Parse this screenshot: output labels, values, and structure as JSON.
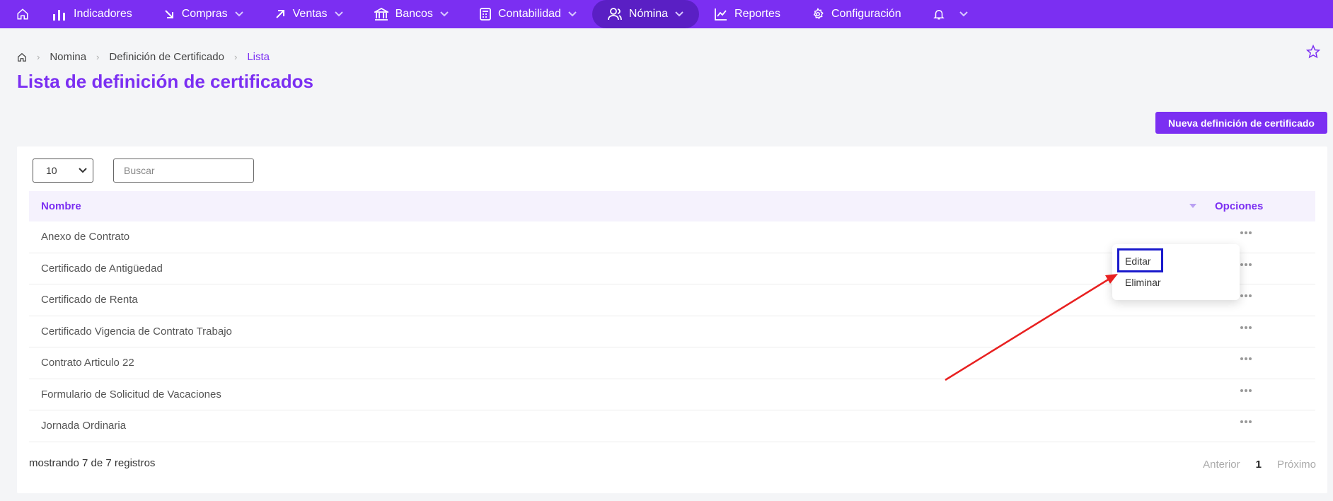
{
  "nav": {
    "items": [
      {
        "label": "Indicadores",
        "dropdown": false
      },
      {
        "label": "Compras",
        "dropdown": true
      },
      {
        "label": "Ventas",
        "dropdown": true
      },
      {
        "label": "Bancos",
        "dropdown": true
      },
      {
        "label": "Contabilidad",
        "dropdown": true
      },
      {
        "label": "Nómina",
        "dropdown": true,
        "active": true
      },
      {
        "label": "Reportes",
        "dropdown": false
      },
      {
        "label": "Configuración",
        "dropdown": false
      }
    ]
  },
  "breadcrumb": {
    "items": [
      "Nomina",
      "Definición de Certificado"
    ],
    "current": "Lista"
  },
  "page": {
    "title": "Lista de definición de certificados",
    "new_button": "Nueva definición de certificado"
  },
  "table": {
    "page_size": "10",
    "search_placeholder": "Buscar",
    "columns": {
      "name": "Nombre",
      "options": "Opciones"
    },
    "rows": [
      "Anexo de Contrato",
      "Certificado de Antigüedad",
      "Certificado de Renta",
      "Certificado Vigencia de Contrato Trabajo",
      "Contrato Articulo 22",
      "Formulario de Solicitud de Vacaciones",
      "Jornada Ordinaria"
    ],
    "footer": "mostrando 7 de 7 registros",
    "pager": {
      "prev": "Anterior",
      "page": "1",
      "next": "Próximo"
    }
  },
  "menu": {
    "edit": "Editar",
    "delete": "Eliminar"
  },
  "colors": {
    "brand": "#7b2ff2",
    "nav_active": "#5a1fc4",
    "highlight": "#1a1acc",
    "arrow": "#e82020"
  }
}
